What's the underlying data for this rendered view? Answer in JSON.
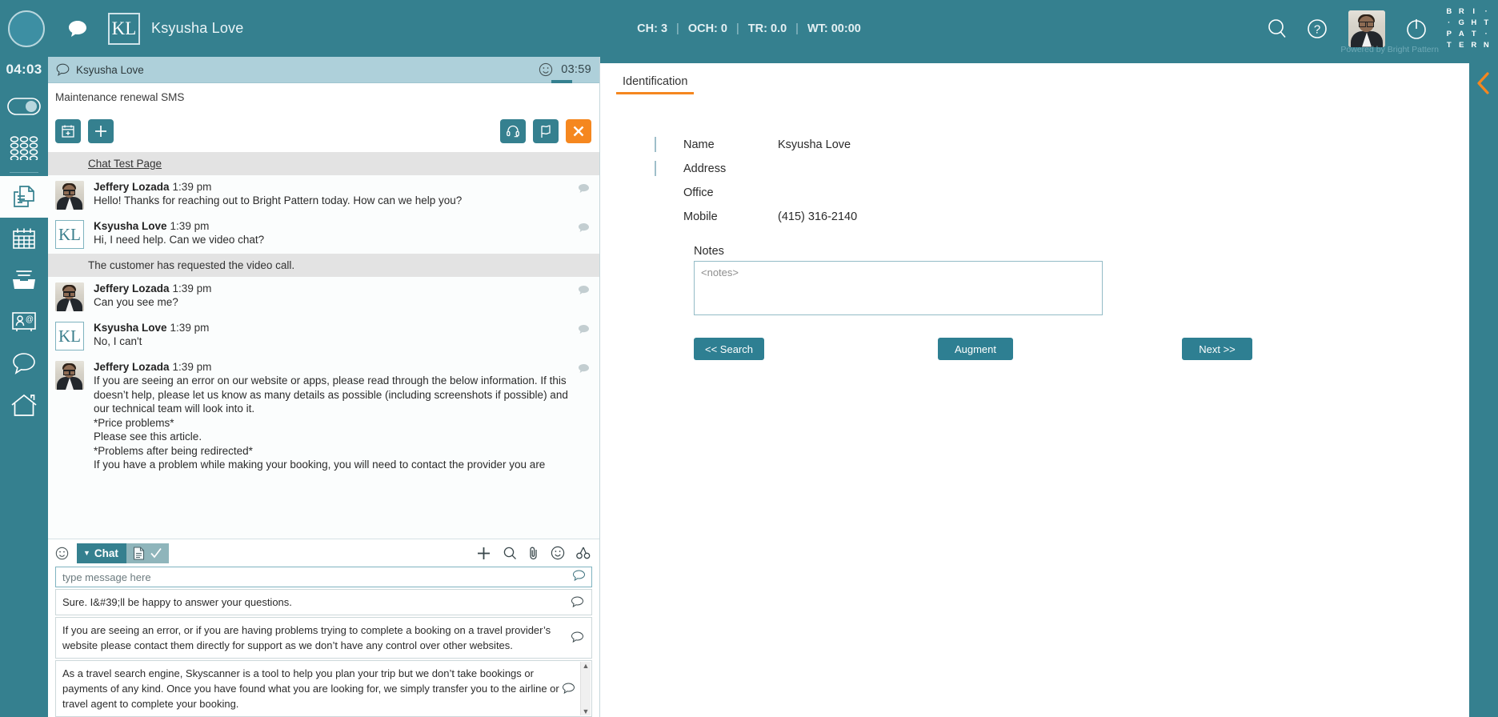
{
  "topbar": {
    "agent_initials": "KL",
    "agent_name": "Ksyusha Love",
    "stats": [
      {
        "label": "CH:",
        "value": "3"
      },
      {
        "label": "OCH:",
        "value": "0"
      },
      {
        "label": "TR:",
        "value": "0.0"
      },
      {
        "label": "WT:",
        "value": "00:00"
      }
    ],
    "stats_text": "CH: 3   |   OCH: 0   |   TR: 0.0   |   WT: 00:00",
    "powered_by": "Powered by Bright Pattern",
    "logo_letters": [
      "B",
      "R",
      "I",
      "·",
      "·",
      "G",
      "H",
      "T",
      "P",
      "A",
      "T",
      "·",
      "T",
      "E",
      "R",
      "N"
    ],
    "icons": {
      "chat": "chat-bubble-icon",
      "search": "search-icon",
      "help": "help-icon",
      "avatar": "agent-photo",
      "power": "power-icon"
    }
  },
  "rail": {
    "clock": "04:03",
    "items": [
      {
        "name": "status-toggle",
        "icon": "toggle-icon",
        "active": false
      },
      {
        "name": "dialpad",
        "icon": "keypad-grid-icon",
        "active": false
      },
      {
        "name": "cases",
        "icon": "documents-icon",
        "active": true
      },
      {
        "name": "calendar",
        "icon": "calendar-icon",
        "active": false
      },
      {
        "name": "inbox",
        "icon": "inbox-tray-icon",
        "active": false
      },
      {
        "name": "contacts",
        "icon": "contact-card-icon",
        "active": false
      },
      {
        "name": "chat",
        "icon": "chat-bubble-icon",
        "active": false
      },
      {
        "name": "home",
        "icon": "home-icon",
        "active": false
      }
    ]
  },
  "chat": {
    "tab_label": "Ksyusha Love",
    "tab_icon": "chat-bubble-icon",
    "smiley_icon": "smiley-icon",
    "timer": "03:59",
    "subject": "Maintenance renewal SMS",
    "actions": {
      "schedule": "calendar-plus-icon",
      "add": "plus-icon",
      "transfer": "headset-icon",
      "flag": "flag-icon",
      "close": "close-x-icon"
    },
    "system_link": "Chat Test Page",
    "system_note": "The customer has requested the video call.",
    "messages": [
      {
        "author": "Jeffery Lozada",
        "time": "1:39 pm",
        "avatar": "agent-photo",
        "text": "Hello! Thanks for reaching out to Bright Pattern today. How can we help you?"
      },
      {
        "author": "Ksyusha Love",
        "time": "1:39 pm",
        "avatar": "KL",
        "text": "Hi, I need help. Can we video chat?"
      },
      {
        "author": "Jeffery Lozada",
        "time": "1:39 pm",
        "avatar": "agent-photo",
        "text": "Can you see me?"
      },
      {
        "author": "Ksyusha Love",
        "time": "1:39 pm",
        "avatar": "KL",
        "text": "No, I can't"
      },
      {
        "author": "Jeffery Lozada",
        "time": "1:39 pm",
        "avatar": "agent-photo",
        "text": "If you are seeing an error on our website or apps, please read through the below information. If this doesn’t help, please let us know as many details as possible (including screenshots if possible) and our technical team will look into it.\n*Price problems*\nPlease see this article.\n*Problems after being redirected*\nIf you have a problem while making your booking, you will need to contact the provider you are"
      }
    ],
    "composer": {
      "smiley_icon": "smiley-icon",
      "mode_label": "Chat",
      "mode_caret": "▼",
      "doc_icon": "document-icon",
      "check_icon": "check-icon",
      "tools": [
        "plus-icon",
        "search-icon",
        "paperclip-icon",
        "emoji-icon",
        "scissors-icon"
      ],
      "input_placeholder": "type message here",
      "input_value": "",
      "suggestions": [
        "Sure. I&#39;ll be happy to answer your questions.",
        "If you are seeing an error, or if you are having problems trying to complete a booking on a travel provider’s website please contact them directly for support as we don’t have any control over other websites.",
        "As a travel search engine, Skyscanner is a tool to help you plan your trip but we don’t take bookings or payments of any kind. Once you have found what you are looking for, we simply transfer you to the airline or travel agent to complete your booking."
      ]
    }
  },
  "right_panel": {
    "tabs": [
      {
        "label": "Identification",
        "active": true
      }
    ],
    "fields": [
      {
        "label": "Name",
        "value": "Ksyusha Love",
        "checkbox": true
      },
      {
        "label": "Address",
        "value": "",
        "checkbox": true
      },
      {
        "label": "Office",
        "value": "",
        "checkbox": false
      },
      {
        "label": "Mobile",
        "value": "(415) 316-2140",
        "checkbox": false
      }
    ],
    "notes_label": "Notes",
    "notes_placeholder": "<notes>",
    "notes_value": "",
    "buttons": {
      "search": "<< Search",
      "augment": "Augment",
      "next": "Next >>"
    }
  },
  "colors": {
    "brand_teal": "#35808f",
    "accent_orange": "#f5871f",
    "tab_bar": "#aed0da"
  }
}
